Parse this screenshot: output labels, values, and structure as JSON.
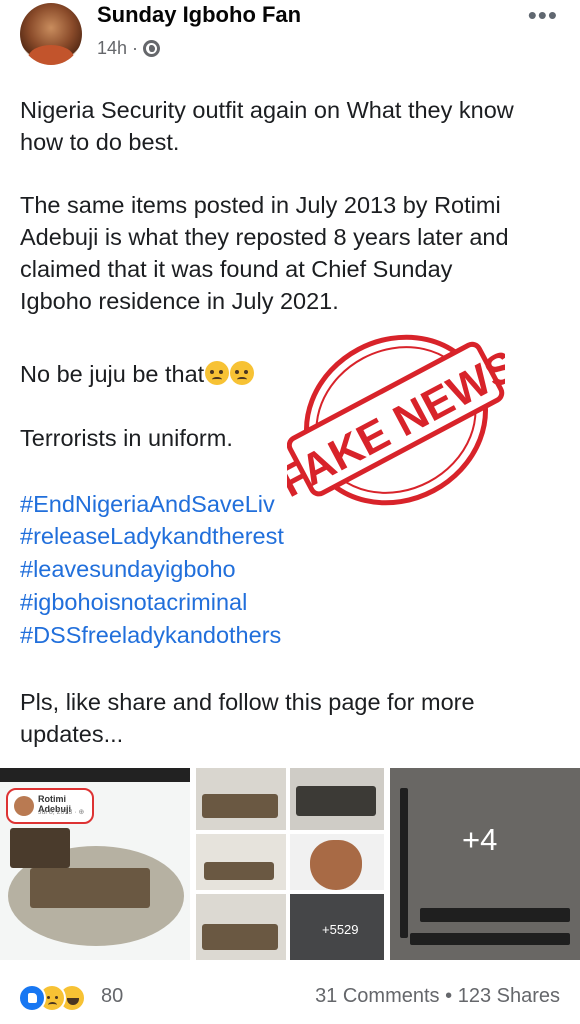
{
  "post": {
    "author": "Sunday Igboho Fan",
    "time": "14h",
    "separator": "·",
    "more_label": "•••",
    "lines": [
      "Nigeria Security outfit again on What they know",
      "how to do best.",
      "The same items posted in July 2013 by Rotimi",
      "Adebuji is what they reposted 8 years later and",
      "claimed that it was found at Chief Sunday",
      "Igboho residence in July 2021.",
      "No be juju be that",
      "Terrorists in uniform."
    ],
    "hashtags": [
      "#EndNigeriaAndSaveLiv",
      "#releaseLadykandtherest",
      "#leavesundayigboho",
      "#igbohoisnotacriminal",
      "#DSSfreeladykandothers"
    ],
    "closing": [
      "Pls, like share and follow this page for more",
      "updates..."
    ],
    "emoji_icons": [
      "sad-face-emoji",
      "sad-face-emoji"
    ]
  },
  "stamp": {
    "text": "FAKE NEWS",
    "color": "#d8232a"
  },
  "photos": {
    "count_overlay": "+4",
    "video_views": "+5529",
    "card_name": "Rotimi Adebuji",
    "card_date": "Jul 8, 2013 · ⊕"
  },
  "footer": {
    "reaction_icons": [
      "like-icon",
      "sad-icon",
      "haha-icon"
    ],
    "reaction_count": "80",
    "comments": "31 Comments",
    "dot": "•",
    "shares": "123 Shares"
  },
  "colors": {
    "hashtag": "#216fdb",
    "meta": "#65676b",
    "text": "#1c1e21"
  }
}
